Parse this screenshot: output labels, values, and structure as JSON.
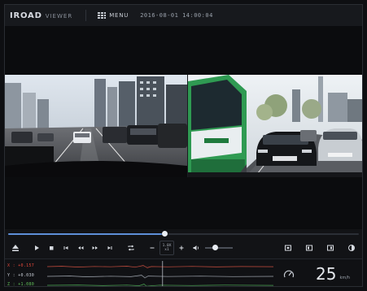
{
  "header": {
    "brand": "IROAD",
    "brand_suffix": "VIEWER",
    "menu_label": "MENU",
    "datetime": "2016-08-01 14:00:04"
  },
  "playback": {
    "progress": 0.445,
    "volume": 0.35,
    "speed_line1": "1.0X",
    "speed_line2": "x1"
  },
  "controls": {
    "icons": [
      "eject-icon",
      "play-icon",
      "stop-icon",
      "skip-start-icon",
      "rewind-icon",
      "fast-forward-icon",
      "skip-end-icon",
      "repeat-icon",
      "speed-down-icon",
      "speed-up-icon",
      "volume-icon",
      "single-view-icon",
      "dual-view-icon",
      "swap-view-icon",
      "contrast-icon"
    ]
  },
  "gsensor": {
    "x_label": "X : +0.157",
    "y_label": "Y : +0.030",
    "z_label": "Z : +1.080",
    "x_color": "#e0483a",
    "y_color": "#c9ced6",
    "z_color": "#63c25b",
    "cursor_position": 0.51
  },
  "speedometer": {
    "value": "25",
    "unit": "km/h",
    "icon": "speedometer-icon"
  },
  "colors": {
    "accent": "#5e8fd8",
    "background": "#121316"
  }
}
